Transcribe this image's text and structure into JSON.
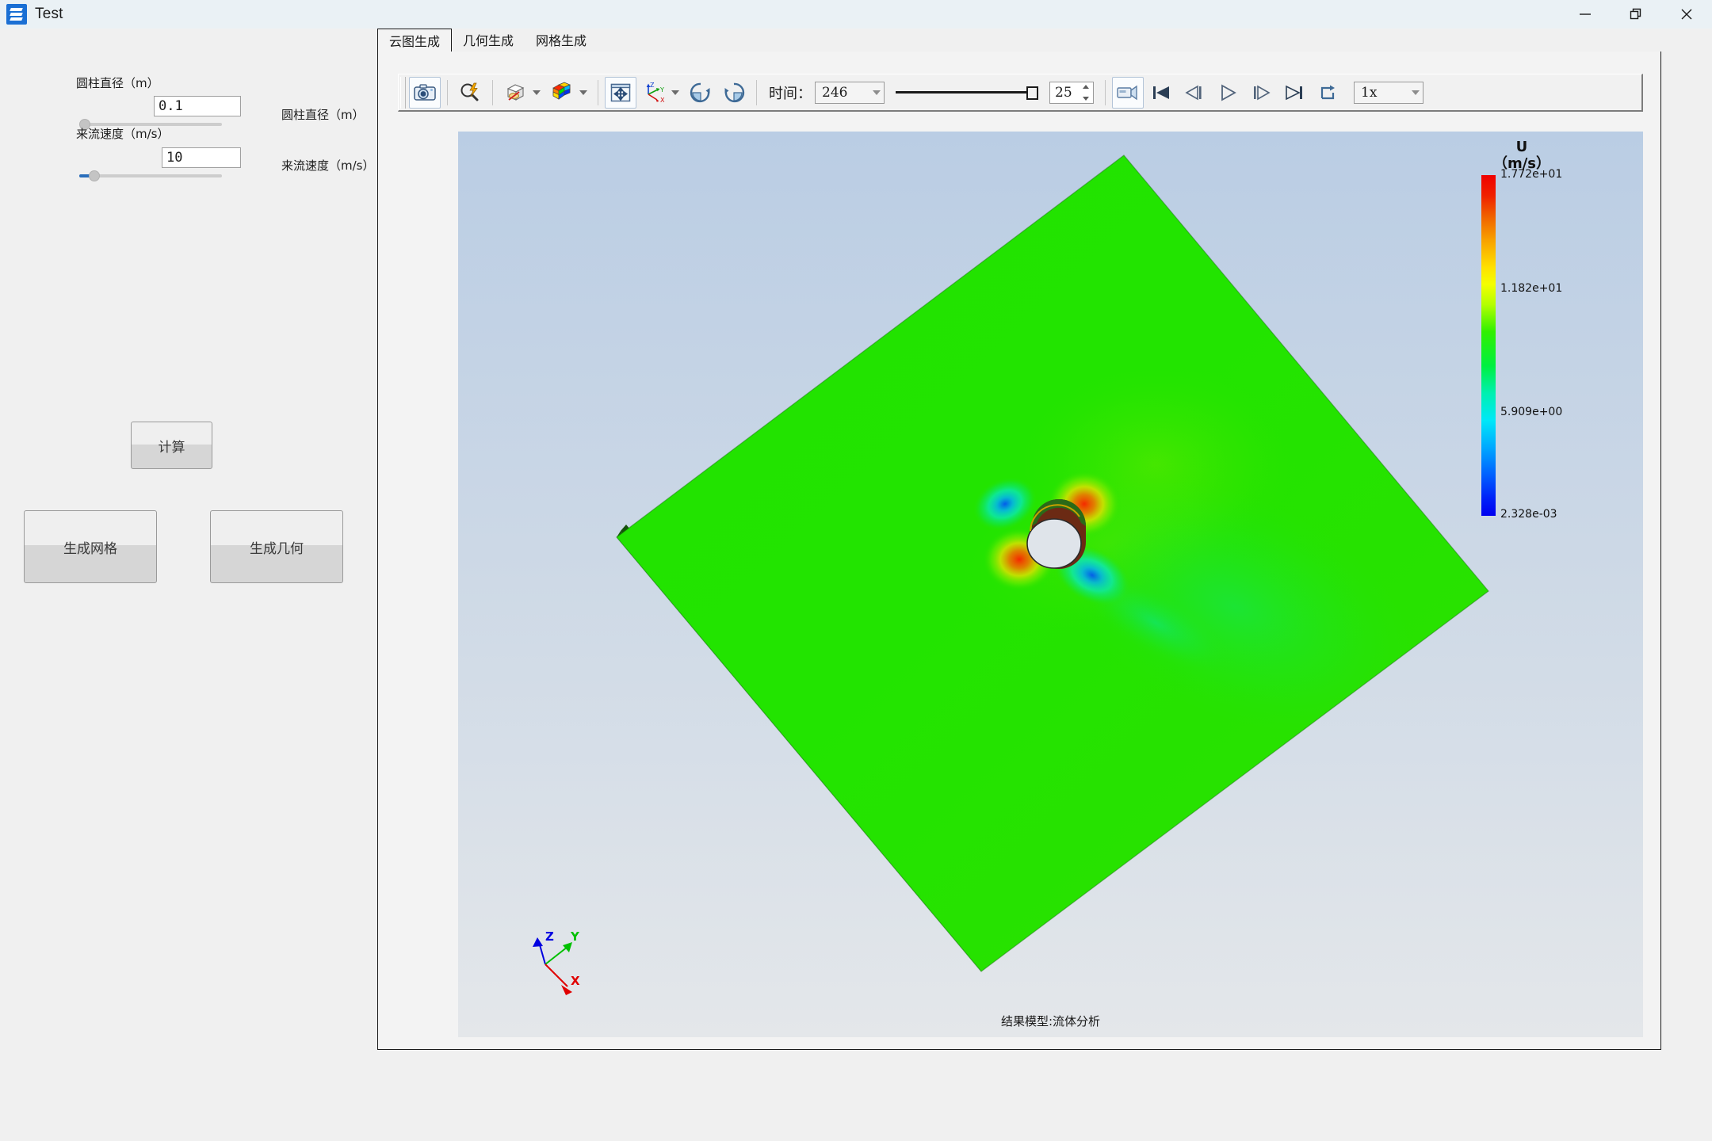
{
  "window": {
    "title": "Test",
    "icon": "app-layers-icon",
    "controls": [
      {
        "name": "minimize-button",
        "glyph": "minimize"
      },
      {
        "name": "restore-button",
        "glyph": "restore"
      },
      {
        "name": "close-button",
        "glyph": "close"
      }
    ]
  },
  "left_panel": {
    "fields": [
      {
        "label": "圆柱直径（m）",
        "value": "0.1",
        "mirror_label": "圆柱直径（m）",
        "slider_percent": 0,
        "slider_fill_percent": 0
      },
      {
        "label": "来流速度（m/s）",
        "value": "10",
        "mirror_label": "来流速度（m/s）",
        "slider_percent": 10,
        "slider_fill_percent": 10
      }
    ],
    "buttons": [
      {
        "name": "calculate-button",
        "label": "计算"
      },
      {
        "name": "generate-mesh-button",
        "label": "生成网格"
      },
      {
        "name": "generate-geometry-button",
        "label": "生成几何"
      }
    ]
  },
  "tabs": [
    {
      "label": "云图生成",
      "active": true
    },
    {
      "label": "几何生成",
      "active": false
    },
    {
      "label": "网格生成",
      "active": false
    }
  ],
  "toolbar": {
    "icons": [
      {
        "name": "screenshot-camera-icon",
        "tooltip": "截图"
      },
      {
        "name": "zoom-to-data-icon",
        "tooltip": "缩放至数据"
      },
      {
        "name": "surface-representation-icon",
        "tooltip": "表面显示"
      },
      {
        "name": "colormap-cube-icon",
        "tooltip": "颜色映射"
      },
      {
        "name": "reset-camera-icon",
        "tooltip": "重置视角"
      },
      {
        "name": "axes-orientation-icon",
        "tooltip": "坐标方向"
      },
      {
        "name": "rotate-cw-icon",
        "tooltip": "顺时针旋转"
      },
      {
        "name": "rotate-ccw-icon",
        "tooltip": "逆时针旋转"
      }
    ],
    "time_label": "时间：",
    "time_value": "246",
    "frame_value": "25",
    "time_slider_percent": 100,
    "playback": [
      {
        "name": "record-animation-button",
        "glyph": "video-camera-icon"
      },
      {
        "name": "first-frame-button",
        "glyph": "skip-back-icon"
      },
      {
        "name": "previous-frame-button",
        "glyph": "step-back-icon"
      },
      {
        "name": "play-button",
        "glyph": "play-icon"
      },
      {
        "name": "next-frame-button",
        "glyph": "step-forward-icon"
      },
      {
        "name": "last-frame-button",
        "glyph": "skip-forward-icon"
      },
      {
        "name": "loop-button",
        "glyph": "loop-icon"
      }
    ],
    "speed_value": "1x"
  },
  "viewport": {
    "status_text": "结果模型:流体分析",
    "axes": [
      {
        "axis": "X",
        "color": "#e00000"
      },
      {
        "axis": "Y",
        "color": "#00c000"
      },
      {
        "axis": "Z",
        "color": "#0000e0"
      }
    ]
  },
  "legend": {
    "title_line1": "U",
    "title_line2": "（m/s）",
    "ticks": [
      "1.772e+01",
      "1.182e+01",
      "5.909e+00",
      "2.328e-03"
    ],
    "tick_positions": [
      0,
      33.5,
      70,
      100
    ],
    "colormap": "jet",
    "max": "1.772e+01",
    "min": "2.328e-03"
  },
  "colors": {
    "accent": "#2a6ebb",
    "titlebar": "#eaf1f5",
    "panel": "#f0f0f0",
    "viewport_top": "#bacde4",
    "viewport_bottom": "#e4e7ea",
    "plane_fill": "#21e000",
    "plane_edge": "#1d6b12"
  }
}
